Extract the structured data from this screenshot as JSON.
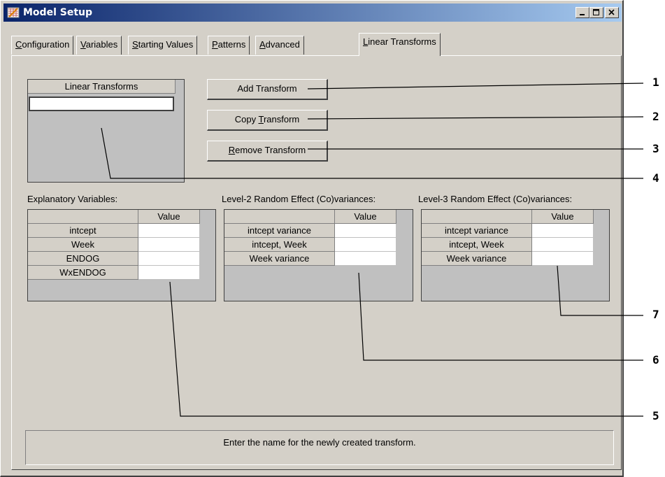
{
  "window": {
    "title": "Model Setup",
    "controls": {
      "minimize": "minimize-icon",
      "maximize": "maximize-icon",
      "close": "close-icon"
    }
  },
  "tabs": [
    {
      "pre": "",
      "key": "C",
      "post": "onfiguration"
    },
    {
      "pre": "",
      "key": "V",
      "post": "ariables"
    },
    {
      "pre": "",
      "key": "S",
      "post": "tarting Values"
    },
    {
      "pre": "",
      "key": "P",
      "post": "atterns"
    },
    {
      "pre": "",
      "key": "A",
      "post": "dvanced"
    },
    {
      "pre": "",
      "key": "L",
      "post": "inear Transforms"
    }
  ],
  "transforms": {
    "header": "Linear Transforms",
    "new_entry_value": ""
  },
  "buttons": {
    "add": {
      "pre": "Add Transform",
      "key": "",
      "post": ""
    },
    "copy": {
      "pre": "Copy ",
      "key": "T",
      "post": "ransform"
    },
    "remove": {
      "pre": "",
      "key": "R",
      "post": "emove Transform"
    }
  },
  "explanatory": {
    "label": "Explanatory Variables:",
    "value_header": "Value",
    "rows": [
      {
        "name": "intcept",
        "value": ""
      },
      {
        "name": "Week",
        "value": ""
      },
      {
        "name": "ENDOG",
        "value": ""
      },
      {
        "name": "WxENDOG",
        "value": ""
      }
    ]
  },
  "level2": {
    "label": "Level-2 Random Effect (Co)variances:",
    "value_header": "Value",
    "rows": [
      {
        "name": "intcept variance",
        "value": ""
      },
      {
        "name": "intcept, Week",
        "value": ""
      },
      {
        "name": "Week variance",
        "value": ""
      }
    ]
  },
  "level3": {
    "label": "Level-3 Random Effect (Co)variances:",
    "value_header": "Value",
    "rows": [
      {
        "name": "intcept variance",
        "value": ""
      },
      {
        "name": "intcept, Week",
        "value": ""
      },
      {
        "name": "Week variance",
        "value": ""
      }
    ]
  },
  "status": {
    "text": "Enter the name for the newly created transform."
  },
  "callouts": [
    "1",
    "2",
    "3",
    "4",
    "5",
    "6",
    "7"
  ]
}
